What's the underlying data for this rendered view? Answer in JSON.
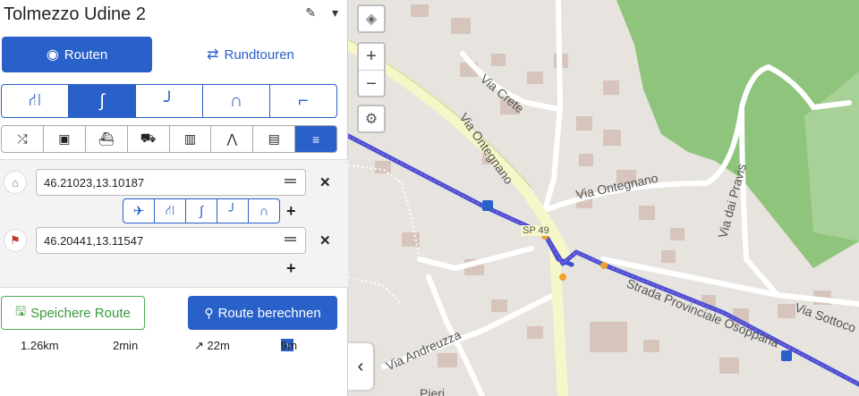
{
  "header": {
    "title": "Tolmezzo Udine 2",
    "edit_icon": "pencil-icon",
    "menu_icon": "caret-down-icon"
  },
  "mode_tabs": [
    {
      "label": "Routen",
      "icon": "compass-icon",
      "active": true
    },
    {
      "label": "Rundtouren",
      "icon": "loop-arrows-icon",
      "active": false
    }
  ],
  "profiles": [
    {
      "icon": "highway-icon",
      "active": false
    },
    {
      "icon": "curvy-road-icon",
      "active": true
    },
    {
      "icon": "curvy-road-2-icon",
      "active": false
    },
    {
      "icon": "curvy-road-3-icon",
      "active": false
    },
    {
      "icon": "curvy-road-4-icon",
      "active": false
    }
  ],
  "filters": [
    {
      "icon": "shuffle-icon",
      "active": false
    },
    {
      "icon": "toll-money-icon",
      "active": false
    },
    {
      "icon": "ferry-icon",
      "active": false
    },
    {
      "icon": "car-icon",
      "active": false
    },
    {
      "icon": "tunnel-icon",
      "active": false
    },
    {
      "icon": "road-narrow-icon",
      "active": false
    },
    {
      "icon": "unpaved-icon",
      "active": false
    },
    {
      "icon": "sliders-icon",
      "active": true
    }
  ],
  "waypoints": {
    "start": {
      "value": "46.21023,13.10187",
      "icon": "home-icon"
    },
    "end": {
      "value": "46.20441,13.11547",
      "icon": "finish-flag-icon"
    },
    "segment_profiles": [
      "swallow-icon",
      "highway-icon",
      "curvy-road-icon",
      "curvy-road-2-icon",
      "curvy-road-3-icon"
    ]
  },
  "actions": {
    "save_label": "Speichere Route",
    "calc_label": "Route berechnen"
  },
  "stats": {
    "distance": "1.26km",
    "duration": "2min",
    "ascent": "↗ 22m",
    "descent": "9m"
  },
  "map": {
    "labels": {
      "via_crete": "Via Crete",
      "via_ontegnano_1": "Via Ontegnano",
      "via_ontegnano_2": "Via Ontegnano",
      "via_dai_pravis": "Via dai Pravis",
      "sp49": "SP 49",
      "strada_prov": "Strada Provinciale Osoppana",
      "via_sottoco": "Via Sottoco",
      "via_andreuzza": "Via Andreuzza",
      "pieri": "Pieri"
    },
    "colors": {
      "route": "#3f51d6",
      "forest": "#8ec47c",
      "land": "#e7e3de",
      "building": "#d7c5bd",
      "major_road": "#f6f7c8"
    }
  }
}
